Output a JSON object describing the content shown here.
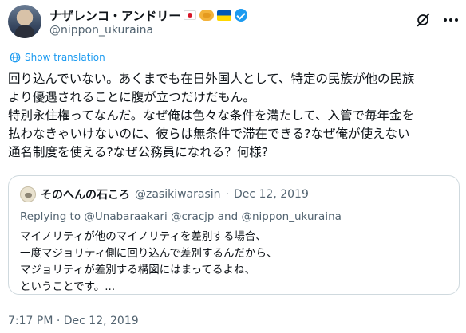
{
  "author": {
    "display_name": "ナザレンコ・アンドリー",
    "handle": "@nippon_ukuraina",
    "badges": [
      "flag-japan-icon",
      "handshake-icon",
      "flag-ukraine-icon",
      "verified-badge-icon"
    ]
  },
  "translation": {
    "label": "Show translation"
  },
  "tweet": {
    "text": "回り込んでいない。あくまでも在日外国人として、特定の民族が他の民族\nより優遇されることに腹が立つだけだもん。\n特別永住権ってなんだ。なぜ俺は色々な条件を満たして、入管で毎年金を\n払わなきゃいけないのに、彼らは無条件で滞在できる?なぜ俺が使えない\n通名制度を使える?なぜ公務員になれる？何様?"
  },
  "quoted_tweet": {
    "display_name": "そのへんの石ころ",
    "handle": "@zasikiwarasin",
    "separator": "·",
    "date": "Dec 12, 2019",
    "reply_prefix": "Replying to ",
    "reply_to": "@Unabaraakari @cracjp and @nippon_ukuraina",
    "text": "マイノリティが他のマイノリティを差別する場合、\n一度マジョリティ側に回り込んで差別するんだから、\nマジョリティが差別する構図にはまってるよね、\nということです。..."
  },
  "meta": {
    "timestamp": "7:17 PM · Dec 12, 2019"
  },
  "colors": {
    "link": "#1d9bf0",
    "secondary_text": "#536471",
    "border": "#cfd9de"
  }
}
